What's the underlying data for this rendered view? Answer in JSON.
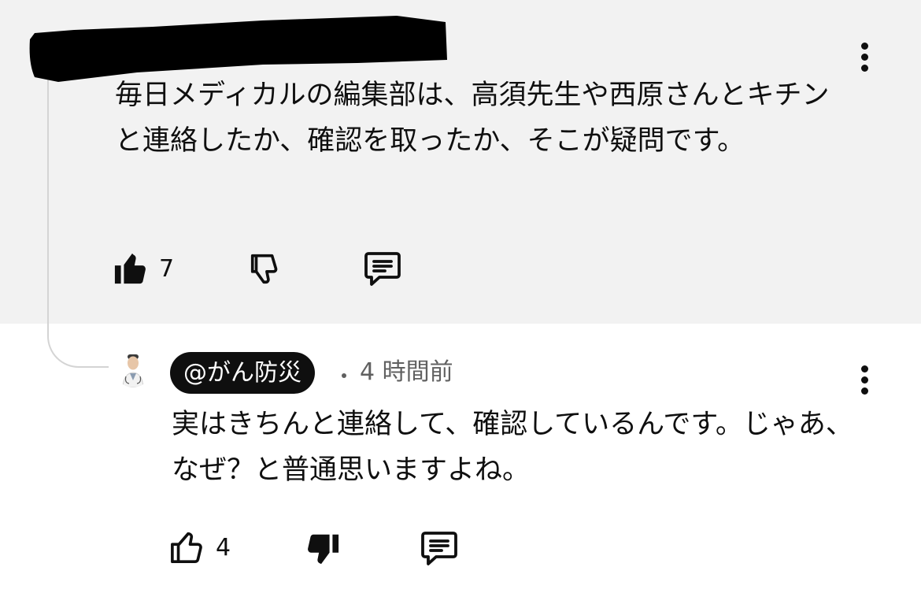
{
  "comment1": {
    "text": "毎日メディカルの編集部は、高須先生や西原さんとキチンと連絡したか、確認を取ったか、そこが疑問です。",
    "like_count": "7"
  },
  "comment2": {
    "author": "@がん防災",
    "timestamp": "4 時間前",
    "text": "実はきちんと連絡して、確認しているんです。じゃあ、なぜ？と普通思いますよね。",
    "like_count": "4"
  },
  "icons": {
    "like_filled": "thumbs-up-filled-icon",
    "like_outline": "thumbs-up-outline-icon",
    "dislike_outline": "thumbs-down-outline-icon",
    "dislike_filled": "thumbs-down-filled-icon",
    "reply": "reply-icon",
    "more": "more-vertical-icon"
  },
  "colors": {
    "highlight_background": "#f2f2f2",
    "text": "#0f0f0f",
    "meta_text": "#606060",
    "author_chip": "#0f0f0f",
    "thread_line": "#d4d4d4"
  }
}
